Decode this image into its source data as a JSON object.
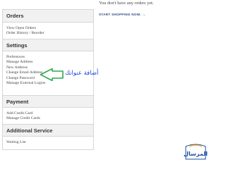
{
  "main": {
    "message": "You don't have any orders yet.",
    "shop_link": "START SHOPPING NOW.",
    "shop_arrow": "→"
  },
  "sidebar": {
    "orders": {
      "title": "Orders",
      "links": [
        "View Open Orders",
        "Order History / Reorder"
      ]
    },
    "settings": {
      "title": "Settings",
      "links": [
        "Preferences",
        "Manage Address",
        "New Address",
        "Change Email Address",
        "Change Password",
        "Manage External Logins"
      ]
    },
    "payment": {
      "title": "Payment",
      "links": [
        "Add Credit Card",
        "Manage Credit Cards"
      ]
    },
    "additional": {
      "title": "Additional Service",
      "links": [
        "Waiting List"
      ]
    }
  },
  "annotation": {
    "text": "أضافة عنوانك",
    "arrow_color": "#2fa84f",
    "text_color": "#1c3fd9"
  },
  "logo": {
    "text": "المرسال",
    "color": "#1b4f9c",
    "accent": "#f5a623"
  }
}
